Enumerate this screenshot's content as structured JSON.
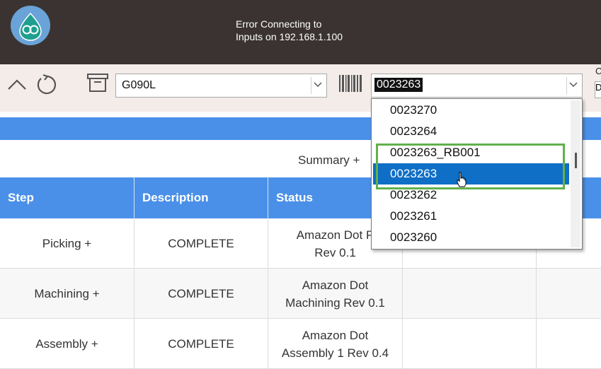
{
  "header": {
    "connection_status": [
      "Error Connecting to",
      "Inputs on 192.168.1.100"
    ]
  },
  "toolbar": {
    "part_value": "G090L",
    "serial_value": "0023263",
    "edge_label": "C",
    "edge_value": "D"
  },
  "summary": {
    "label": "Summary  +"
  },
  "table": {
    "columns": [
      "Step",
      "Description",
      "Status",
      "",
      ""
    ],
    "rows": [
      {
        "step": "Picking  +",
        "description": "COMPLETE",
        "status": "Amazon Dot P\nRev 0.1"
      },
      {
        "step": "Machining  +",
        "description": "COMPLETE",
        "status": "Amazon Dot\nMachining Rev 0.1"
      },
      {
        "step": "Assembly  +",
        "description": "COMPLETE",
        "status": "Amazon Dot\nAssembly 1 Rev 0.4"
      }
    ]
  },
  "dropdown": {
    "options": [
      "0023270",
      "0023264",
      "0023263_RB001",
      "0023263",
      "0023262",
      "0023261",
      "0023260"
    ],
    "selected_index": 3
  },
  "colors": {
    "topbar": "#3a3331",
    "toolbar": "#f3ece9",
    "accent_blue": "#4a90e8",
    "selection_blue": "#0f6fc6",
    "highlight_green": "#63b04b"
  }
}
